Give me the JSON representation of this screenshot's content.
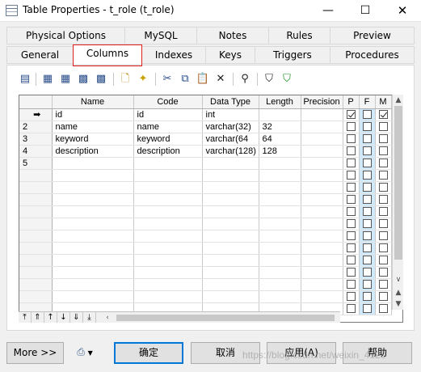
{
  "window": {
    "title": "Table Properties - t_role (t_role)",
    "minimize": "—",
    "maximize": "☐",
    "close": "✕"
  },
  "tabs_back": [
    "Physical Options",
    "MySQL",
    "Notes",
    "Rules",
    "Preview"
  ],
  "tabs_front": [
    "General",
    "Columns",
    "Indexes",
    "Keys",
    "Triggers",
    "Procedures"
  ],
  "active_tab": "Columns",
  "grid": {
    "headers": [
      "Name",
      "Code",
      "Data Type",
      "Length",
      "Precision",
      "P",
      "F",
      "M"
    ],
    "rows": [
      {
        "num": "",
        "marker": "➡",
        "name": "id",
        "code": "id",
        "type": "int",
        "length": "",
        "p": true,
        "m": true
      },
      {
        "num": "2",
        "name": "name",
        "code": "name",
        "type": "varchar(32)",
        "length": "32",
        "p": false,
        "m": false
      },
      {
        "num": "3",
        "name": "keyword",
        "code": "keyword",
        "type": "varchar(64",
        "length": "64",
        "p": false,
        "m": false
      },
      {
        "num": "4",
        "name": "description",
        "code": "description",
        "type": "varchar(128)",
        "length": "128",
        "p": false,
        "m": false
      },
      {
        "num": "5",
        "name": "",
        "code": "",
        "type": "",
        "length": "",
        "p": false,
        "m": false
      }
    ]
  },
  "buttons": {
    "more": "More >>",
    "ok": "确定",
    "cancel": "取消",
    "apply": "应用(A)",
    "help": "帮助"
  },
  "watermark": "https://blog.csdn.net/weixin_4123"
}
